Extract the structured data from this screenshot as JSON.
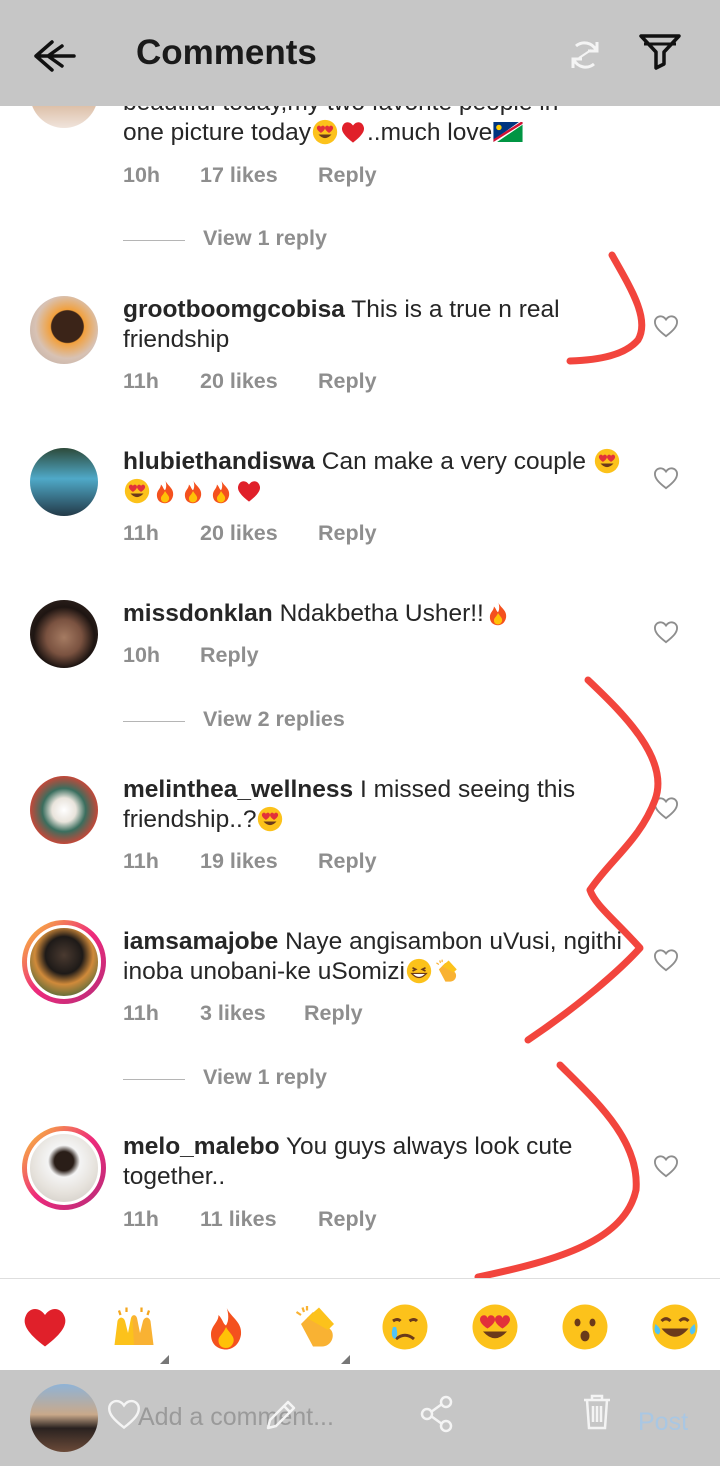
{
  "header": {
    "title": "Comments",
    "back_icon": "back-arrow-icon",
    "sync_icon": "sync-icon",
    "filter_icon": "filter-icon"
  },
  "comments": [
    {
      "username": "",
      "text": "beautiful today,my two favorite people in",
      "text2": "one picture today",
      "text2_suffix": "..much love",
      "time": "10h",
      "likes": "17 likes",
      "reply": "Reply",
      "view_replies": "View 1 reply"
    },
    {
      "username": "grootboomgcobisa",
      "text": "This is a true n real friendship",
      "time": "11h",
      "likes": "20 likes",
      "reply": "Reply"
    },
    {
      "username": "hlubiethandiswa",
      "text": "Can make a very couple",
      "time": "11h",
      "likes": "20 likes",
      "reply": "Reply"
    },
    {
      "username": "missdonklan",
      "text": "Ndakbetha Usher!!",
      "time": "10h",
      "reply": "Reply",
      "view_replies": "View 2 replies"
    },
    {
      "username": "melinthea_wellness",
      "text": "I missed seeing this friendship..?",
      "time": "11h",
      "likes": "19 likes",
      "reply": "Reply"
    },
    {
      "username": "iamsamajobe",
      "text": "Naye angisambon uVusi, ngithi inoba unobani-ke uSomizi",
      "time": "11h",
      "likes": "3 likes",
      "reply": "Reply",
      "view_replies": "View 1 reply"
    },
    {
      "username": "melo_malebo",
      "text": "You guys always look cute together..",
      "time": "11h",
      "likes": "11 likes",
      "reply": "Reply"
    }
  ],
  "emoji_bar": [
    "red-heart",
    "raising-hands",
    "fire",
    "clapping-hands",
    "crying-face",
    "heart-eyes-face",
    "surprised-face",
    "tears-of-joy-face"
  ],
  "composer": {
    "placeholder": "Add a comment...",
    "post": "Post"
  },
  "colors": {
    "bar_gray": "#c6c6c6",
    "meta_gray": "#8e8e8e",
    "scribble_red": "#f2453d",
    "post_blue": "#a9c7e3"
  }
}
